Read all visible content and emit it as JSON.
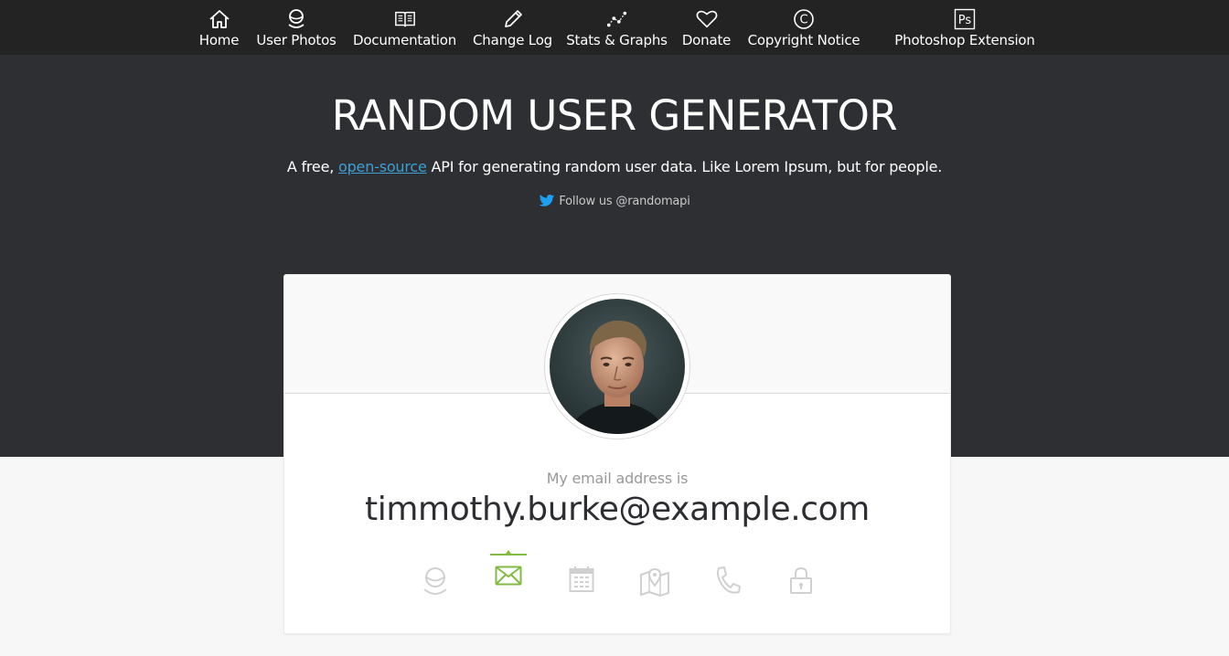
{
  "colors": {
    "nav_bg": "#232323",
    "hero_bg": "#2e2f33",
    "page_bg": "#f7f7f7",
    "accent_green": "#83ba43",
    "link_blue": "#3d9fd4",
    "twitter_blue": "#1da1f2",
    "inactive_icon": "#d0d0d0"
  },
  "nav": {
    "items": [
      {
        "label": "Home",
        "icon": "home-icon"
      },
      {
        "label": "User Photos",
        "icon": "user-photos-icon"
      },
      {
        "label": "Documentation",
        "icon": "book-icon"
      },
      {
        "label": "Change Log",
        "icon": "pencil-icon"
      },
      {
        "label": "Stats & Graphs",
        "icon": "stats-graph-icon"
      },
      {
        "label": "Donate",
        "icon": "heart-icon"
      },
      {
        "label": "Copyright Notice",
        "icon": "copyright-icon"
      },
      {
        "label": "Photoshop Extension",
        "icon": "photoshop-icon"
      }
    ],
    "ps_icon_text": "Ps",
    "copyright_symbol": "C"
  },
  "hero": {
    "title": "RANDOM USER GENERATOR",
    "subtitle_prefix": "A free, ",
    "subtitle_link": "open-source",
    "subtitle_suffix": " API for generating random user data. Like Lorem Ipsum, but for people.",
    "follow_text": "Follow us @randomapi"
  },
  "card": {
    "label": "My email address is",
    "value": "timmothy.burke@example.com",
    "tabs": [
      {
        "icon": "user-icon",
        "active": false
      },
      {
        "icon": "envelope-icon",
        "active": true
      },
      {
        "icon": "calendar-icon",
        "active": false
      },
      {
        "icon": "map-icon",
        "active": false
      },
      {
        "icon": "phone-icon",
        "active": false
      },
      {
        "icon": "lock-icon",
        "active": false
      }
    ]
  }
}
